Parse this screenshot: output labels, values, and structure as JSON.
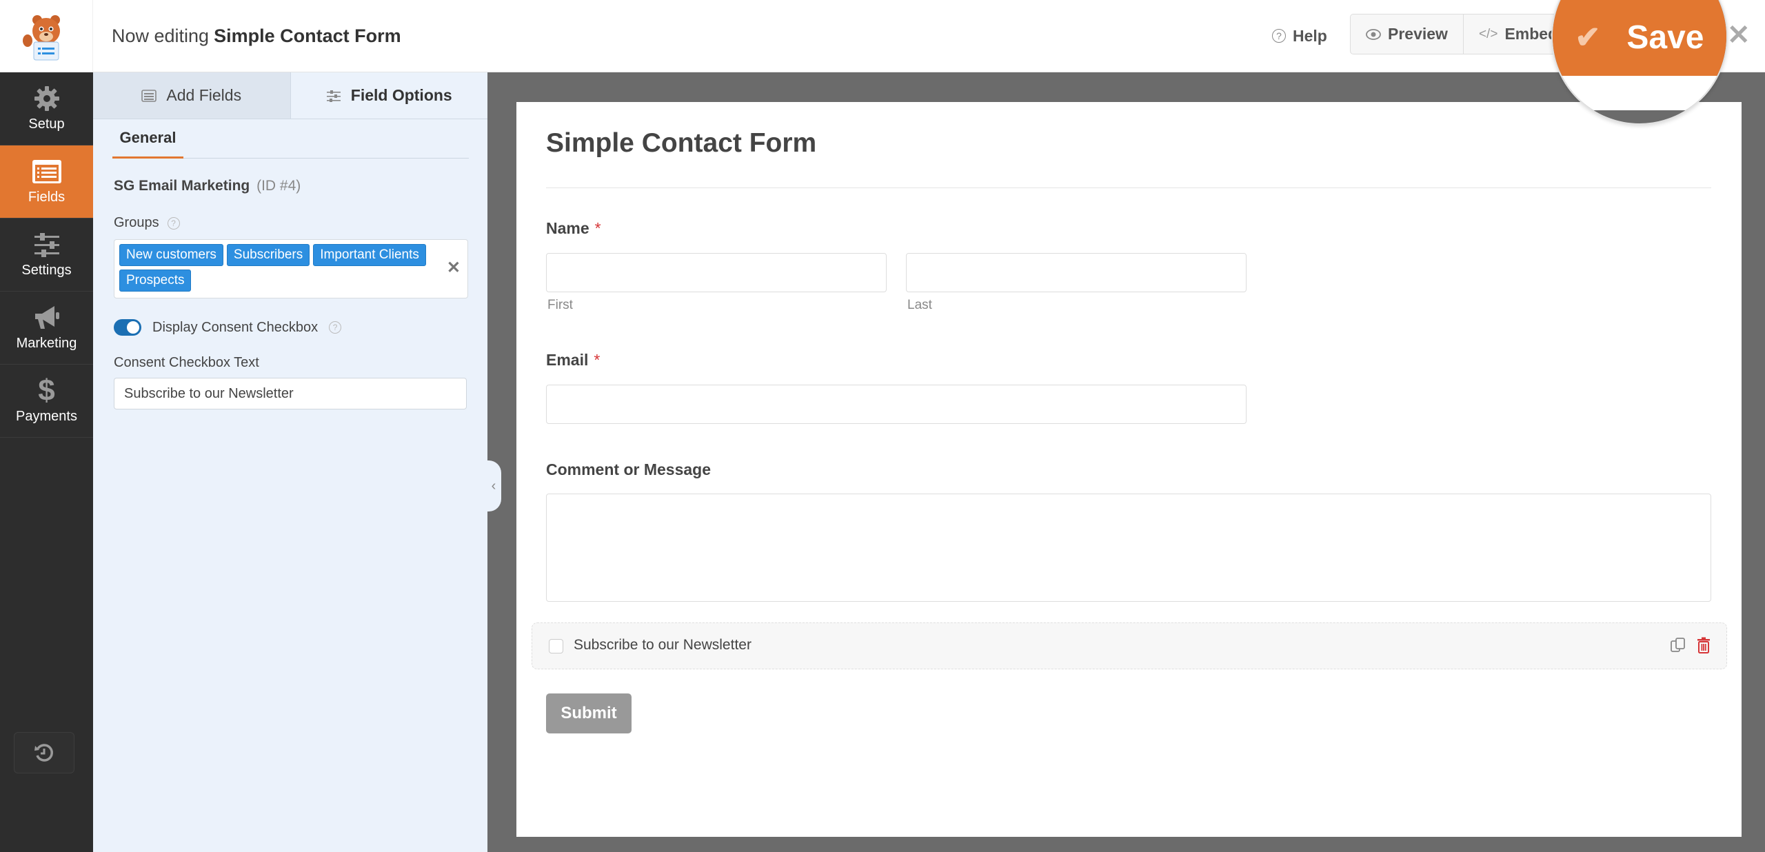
{
  "header": {
    "title_prefix": "Now editing",
    "form_name": "Simple Contact Form",
    "help_label": "Help",
    "preview_label": "Preview",
    "embed_label": "Embed",
    "save_label": "Save"
  },
  "sidebar": {
    "items": [
      {
        "label": "Setup",
        "icon": "gear-icon",
        "active": false
      },
      {
        "label": "Fields",
        "icon": "fields-list-icon",
        "active": true
      },
      {
        "label": "Settings",
        "icon": "sliders-icon",
        "active": false
      },
      {
        "label": "Marketing",
        "icon": "megaphone-icon",
        "active": false
      },
      {
        "label": "Payments",
        "icon": "dollar-icon",
        "active": false
      }
    ]
  },
  "panel": {
    "tabs": [
      {
        "label": "Add Fields",
        "active": false
      },
      {
        "label": "Field Options",
        "active": true
      }
    ],
    "subtab": "General",
    "field_name": "SG Email Marketing",
    "field_id": "(ID #4)",
    "groups_label": "Groups",
    "groups": [
      "New customers",
      "Subscribers",
      "Important Clients",
      "Prospects"
    ],
    "consent_toggle_label": "Display Consent Checkbox",
    "consent_toggle_on": true,
    "consent_text_label": "Consent Checkbox Text",
    "consent_text_value": "Subscribe to our Newsletter"
  },
  "form": {
    "title": "Simple Contact Form",
    "name_label": "Name",
    "first_sublabel": "First",
    "last_sublabel": "Last",
    "email_label": "Email",
    "required_mark": "*",
    "message_label": "Comment or Message",
    "consent_label": "Subscribe to our Newsletter",
    "submit_label": "Submit"
  },
  "colors": {
    "accent": "#e27730",
    "chip_blue": "#2d8fe0",
    "toggle_blue": "#1b6fb3",
    "required_red": "#d63638",
    "sidebar_bg": "#2d2d2d",
    "panel_bg": "#ebf2fb"
  }
}
